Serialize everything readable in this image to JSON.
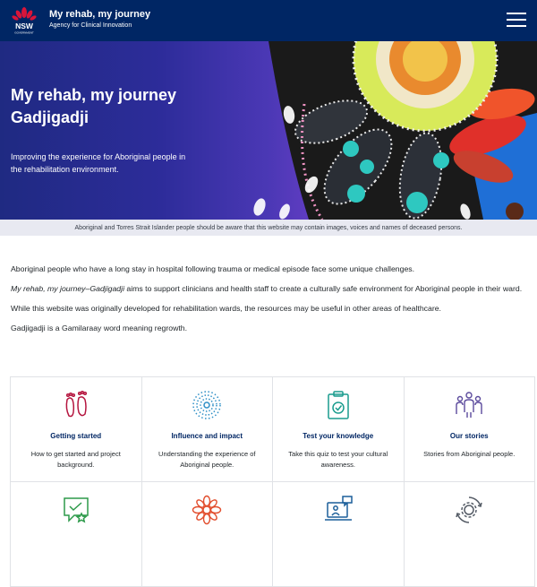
{
  "header": {
    "logo_text": "NSW",
    "logo_sub": "GOVERNMENT",
    "title": "My rehab, my journey",
    "subtitle": "Agency for Clinical Innovation",
    "menu_icon": "hamburger-menu-icon"
  },
  "hero": {
    "title_line1": "My rehab, my journey",
    "title_line2": "Gadjigadji",
    "subtitle": "Improving the experience for Aboriginal people in the rehabilitation environment."
  },
  "warning": "Aboriginal and Torres Strait Islander people should be aware that this website may contain images, voices and names of deceased persons.",
  "intro": {
    "p1": "Aboriginal people who have a long stay in hospital following trauma or medical episode face some unique challenges.",
    "p2_em": "My rehab, my journey–Gadjigadji",
    "p2_rest": " aims to support clinicians and health staff to create a culturally safe environment for Aboriginal people in their ward.",
    "p3": "While this website was originally developed for rehabilitation wards, the resources may be useful in other areas of healthcare.",
    "p4": "Gadjigadji is a Gamilaraay word meaning regrowth."
  },
  "cards": [
    {
      "title": "Getting started",
      "desc": "How to get started and project background.",
      "icon": "footprints-icon",
      "color": "#b5153f"
    },
    {
      "title": "Influence and impact",
      "desc": "Understanding the experience of Aboriginal people.",
      "icon": "ripple-dots-icon",
      "color": "#2e8fc6"
    },
    {
      "title": "Test your knowledge",
      "desc": "Take this quiz to test your cultural awareness.",
      "icon": "clipboard-check-icon",
      "color": "#1a9c8e"
    },
    {
      "title": "Our stories",
      "desc": "Stories from Aboriginal people.",
      "icon": "people-icon",
      "color": "#5b4a9c"
    },
    {
      "title": "",
      "desc": "",
      "icon": "chat-star-icon",
      "color": "#2d9a4a"
    },
    {
      "title": "",
      "desc": "",
      "icon": "flower-icon",
      "color": "#e24e2e"
    },
    {
      "title": "",
      "desc": "",
      "icon": "laptop-chat-icon",
      "color": "#1c5f9a"
    },
    {
      "title": "",
      "desc": "",
      "icon": "cycle-gear-icon",
      "color": "#555c66"
    }
  ],
  "colors": {
    "header_bg": "#002664",
    "hero_gradient_start": "#1f2a82",
    "hero_gradient_end": "#8d4fd0",
    "warning_bg": "#e8e9f1",
    "card_title": "#002664"
  }
}
